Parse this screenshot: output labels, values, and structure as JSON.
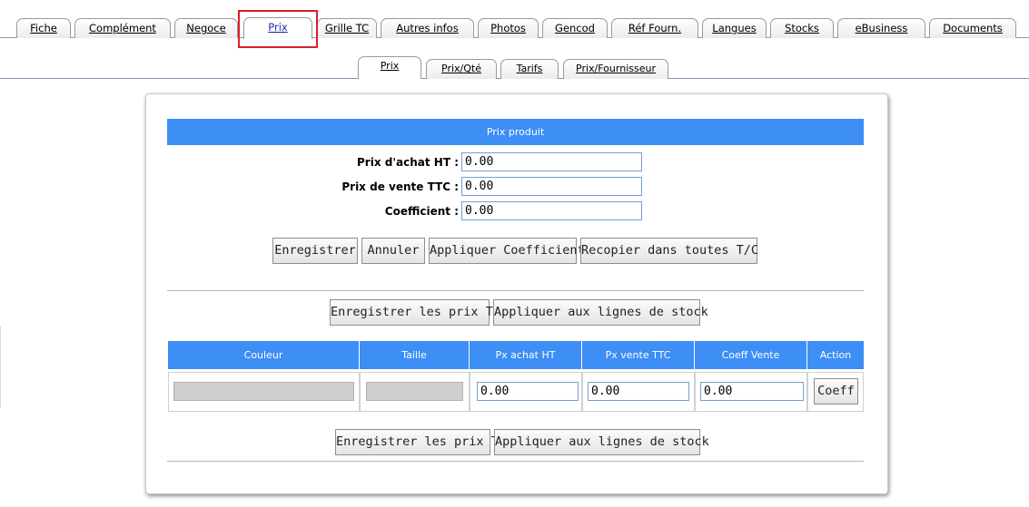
{
  "main_tabs": [
    {
      "label": "Fiche"
    },
    {
      "label": "Complément"
    },
    {
      "label": "Negoce"
    },
    {
      "label": "Prix"
    },
    {
      "label": "Grille TC"
    },
    {
      "label": "Autres infos"
    },
    {
      "label": "Photos"
    },
    {
      "label": "Gencod"
    },
    {
      "label": "Réf Fourn."
    },
    {
      "label": "Langues"
    },
    {
      "label": "Stocks"
    },
    {
      "label": "eBusiness"
    },
    {
      "label": "Documents"
    }
  ],
  "active_main_tab": "Prix",
  "sub_tabs": [
    {
      "label": "Prix"
    },
    {
      "label": "Prix/Qté"
    },
    {
      "label": "Tarifs"
    },
    {
      "label": "Prix/Fournisseur"
    }
  ],
  "active_sub_tab": "Prix",
  "section_title": "Prix produit",
  "form": {
    "purchase_label": "Prix d'achat HT :",
    "purchase_value": "0.00",
    "sale_label": "Prix de vente TTC :",
    "sale_value": "0.00",
    "coef_label": "Coefficient :",
    "coef_value": "0.00"
  },
  "buttons": {
    "save": "Enregistrer",
    "cancel": "Annuler",
    "apply_coef": "Appliquer Coefficient",
    "copy_all": "Recopier dans toutes T/C",
    "save_tc": "Enregistrer les prix TC",
    "apply_stock": "Appliquer aux lignes de stock"
  },
  "grid": {
    "headers": [
      "Couleur",
      "Taille",
      "Px achat HT",
      "Px vente TTC",
      "Coeff Vente",
      "Action"
    ],
    "row": {
      "px_achat": "0.00",
      "px_vente": "0.00",
      "coeff": "0.00",
      "action": "Coeff"
    }
  },
  "colors": {
    "accent_blue": "#3d8ef5",
    "highlight_red": "#d8202a"
  }
}
